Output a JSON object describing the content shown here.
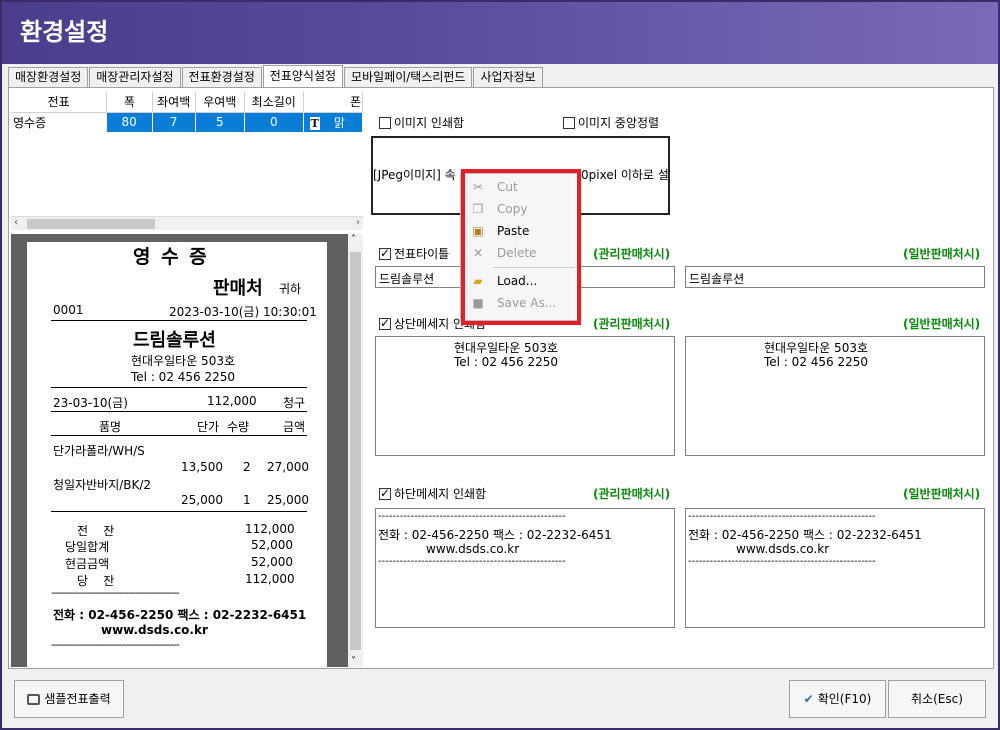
{
  "window": {
    "title": "환경설정"
  },
  "tabs": [
    "매장환경설정",
    "매장관리자설정",
    "전표환경설정",
    "전표양식설정",
    "모바일페이/택스리펀드",
    "사업자정보"
  ],
  "grid": {
    "headers": [
      "전표",
      "폭",
      "좌여백",
      "우여백",
      "최소길이",
      "폰"
    ],
    "row": [
      "영수증",
      "80",
      "7",
      "5",
      "0",
      "T",
      "맑"
    ]
  },
  "receipt": {
    "title": "영 수 증",
    "seller": "판매처",
    "honorific": "귀하",
    "number": "0001",
    "datetime": "2023-03-10(금) 10:30:01",
    "shop": "드림솔루션",
    "address": "현대우일타운 503호",
    "tel": "Tel : 02 456 2250",
    "date_short": "23-03-10(금)",
    "amount": "112,000",
    "claim": "청구",
    "col_item": "품명",
    "col_price": "단가",
    "col_qty": "수량",
    "col_amount": "금액",
    "items": [
      {
        "name": "단가라폴라/WH/S",
        "price": "13,500",
        "qty": "2",
        "amount": "27,000"
      },
      {
        "name": "청일자반바지/BK/2",
        "price": "25,000",
        "qty": "1",
        "amount": "25,000"
      }
    ],
    "summary": [
      {
        "label": "전    잔",
        "value": "112,000"
      },
      {
        "label": "당일합계",
        "value": "52,000"
      },
      {
        "label": "현금금액",
        "value": "52,000"
      },
      {
        "label": "당    잔",
        "value": "112,000"
      }
    ],
    "dashes": "-------------------------------------------",
    "footer_phone": "전화 : 02-456-2250   팩스 : 02-2232-6451",
    "footer_web": "www.dsds.co.kr"
  },
  "settings": {
    "image_print": "이미지 인쇄함",
    "image_center": "이미지 중앙정렬",
    "image_box_left": "[JPeg이미지] 속",
    "image_box_right": "0pixel 이하로 설",
    "title_print": "전표타이틀",
    "top_msg": "상단메세지 인쇄함",
    "bottom_msg": "하단메세지 인쇄함",
    "managed_seller": "(관리판매처시)",
    "general_seller": "(일반판매처시)",
    "title_value_left": "드림솔루션",
    "title_value_right": "드림솔루션",
    "top_line1": "현대우일타운 503호",
    "top_line2": "Tel : 02 456 2250",
    "bottom_dash": "----------------------------------------------------",
    "bottom_phone": "전화 : 02-456-2250    팩스 : 02-2232-6451",
    "bottom_web": "www.dsds.co.kr"
  },
  "context_menu": {
    "items": [
      {
        "label": "Cut",
        "enabled": false,
        "icon": "cut-icon"
      },
      {
        "label": "Copy",
        "enabled": false,
        "icon": "copy-icon"
      },
      {
        "label": "Paste",
        "enabled": true,
        "icon": "paste-icon"
      },
      {
        "label": "Delete",
        "enabled": false,
        "icon": "delete-icon"
      },
      {
        "label": "Load...",
        "enabled": true,
        "icon": "folder-icon"
      },
      {
        "label": "Save As...",
        "enabled": false,
        "icon": "save-icon"
      }
    ]
  },
  "buttons": {
    "sample_print": "샘플전표출력",
    "ok": "확인(F10)",
    "cancel": "취소(Esc)"
  },
  "colors": {
    "title_bar": "#4b3c8c",
    "selection": "#0a7dd6",
    "green_label": "#0a8a0a",
    "highlight": "#e41e26"
  }
}
